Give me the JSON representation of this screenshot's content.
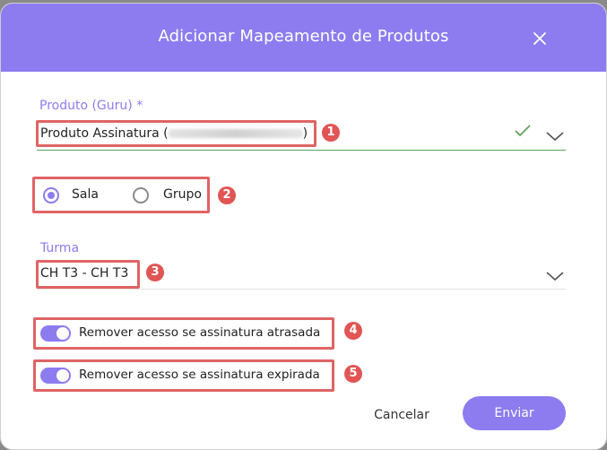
{
  "modal": {
    "title": "Adicionar Mapeamento de Produtos",
    "close_icon": "close-icon"
  },
  "product_field": {
    "label": "Produto (Guru) *",
    "value_prefix": "Produto Assinatura (",
    "value_suffix": ")",
    "status_icon": "check-icon",
    "dropdown_icon": "chevron-down-icon"
  },
  "type_selector": {
    "options": [
      {
        "label": "Sala",
        "selected": true
      },
      {
        "label": "Grupo",
        "selected": false
      }
    ]
  },
  "class_field": {
    "label": "Turma",
    "value": "CH T3 - CH T3",
    "dropdown_icon": "chevron-down-icon"
  },
  "toggles": [
    {
      "label": "Remover acesso se assinatura atrasada",
      "on": true
    },
    {
      "label": "Remover acesso se assinatura expirada",
      "on": true
    }
  ],
  "annotations": [
    "1",
    "2",
    "3",
    "4",
    "5"
  ],
  "actions": {
    "cancel_label": "Cancelar",
    "submit_label": "Enviar"
  },
  "colors": {
    "accent": "#8c7cf0",
    "annotation_red": "#e25555",
    "valid_green": "#5aa05a"
  }
}
